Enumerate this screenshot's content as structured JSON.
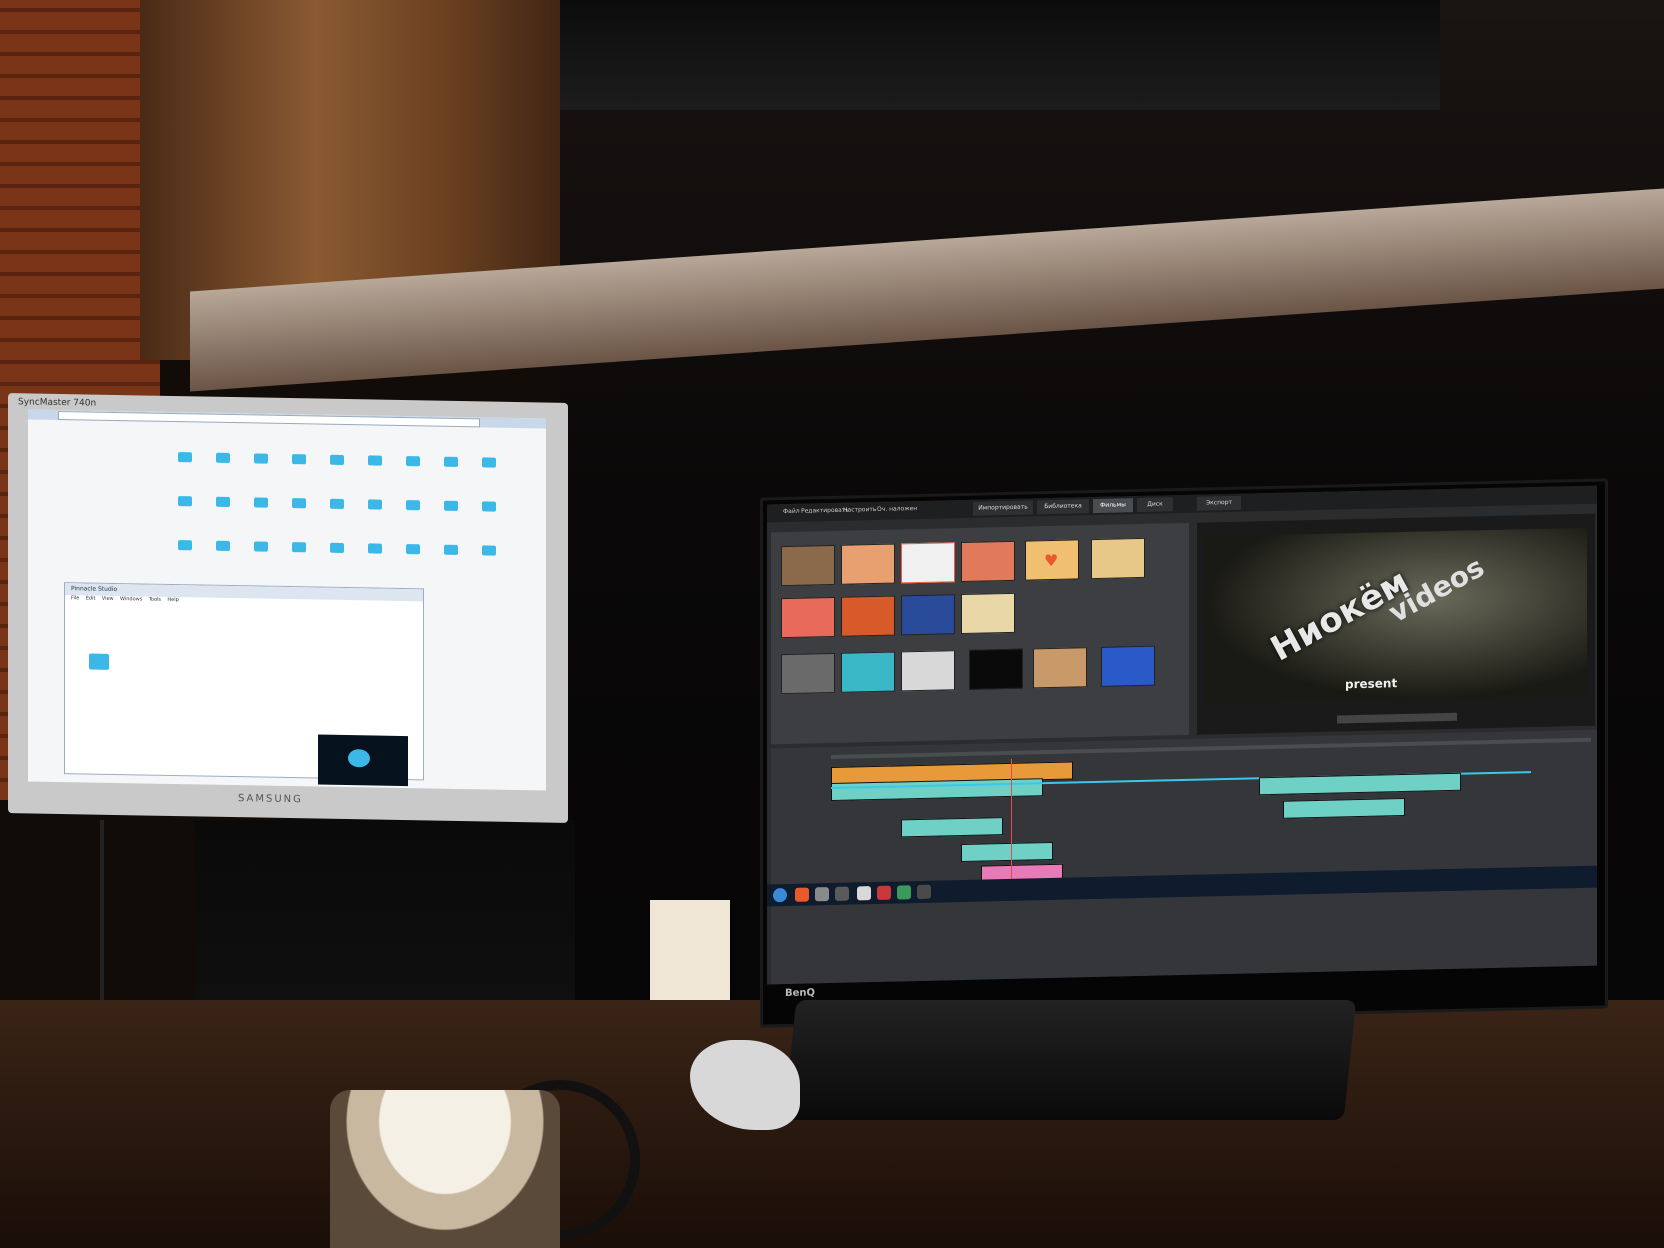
{
  "scene": "photo-of-dual-monitor-video-editing-desk",
  "left_monitor": {
    "brand_label": "SyncMaster 740n",
    "logo": "SAMSUNG",
    "window_title": "Pinnacle Studio",
    "menu": [
      "File",
      "Edit",
      "View",
      "Windows",
      "Tools",
      "Help"
    ]
  },
  "right_monitor": {
    "logo": "BenQ",
    "menubar": [
      "Файл",
      "Редактировать",
      "Настроить",
      "Оч. наложен"
    ],
    "tabs": [
      {
        "label": "Импортировать",
        "active": false
      },
      {
        "label": "Библиотека",
        "active": false
      },
      {
        "label": "Фильмы",
        "active": true
      },
      {
        "label": "Диск",
        "active": false
      },
      {
        "label": "Экспорт",
        "active": false
      }
    ],
    "preview": {
      "title_text": "Ниокём",
      "videos_text": "videos",
      "present_text": "present"
    }
  },
  "colors": {
    "clip_teal": "#6fd0c6",
    "clip_pink": "#e87ab8",
    "clip_orange": "#e89a3a",
    "screen_bg": "#2a2c2e"
  }
}
